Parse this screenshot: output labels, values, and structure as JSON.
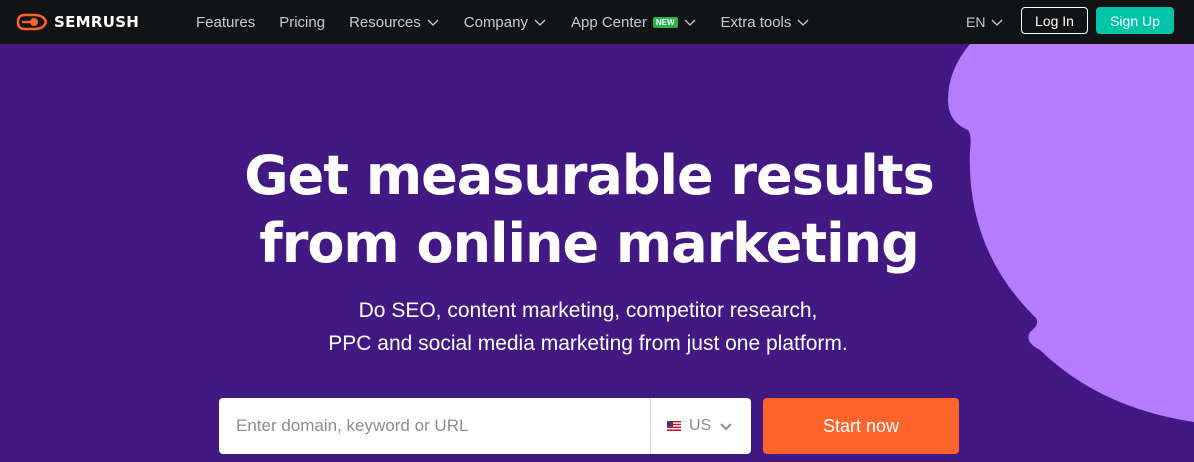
{
  "nav": {
    "logo_text": "SEMRUSH",
    "items": [
      {
        "label": "Features",
        "has_dropdown": false
      },
      {
        "label": "Pricing",
        "has_dropdown": false
      },
      {
        "label": "Resources",
        "has_dropdown": true
      },
      {
        "label": "Company",
        "has_dropdown": true
      },
      {
        "label": "App Center",
        "has_dropdown": true,
        "badge": "NEW"
      },
      {
        "label": "Extra tools",
        "has_dropdown": true
      }
    ],
    "language": "EN",
    "login_label": "Log In",
    "signup_label": "Sign Up"
  },
  "hero": {
    "headline_line1": "Get measurable results",
    "headline_line2": "from online marketing",
    "subtitle_line1": "Do SEO, content marketing, competitor research,",
    "subtitle_line2": "PPC and social media marketing from just one platform.",
    "search_placeholder": "Enter domain, keyword or URL",
    "database": "US",
    "start_label": "Start now"
  },
  "colors": {
    "nav_bg": "#121315",
    "hero_bg": "#421983",
    "decor_purple": "#b47cff",
    "signup_green": "#00c4a7",
    "start_orange": "#ff642d",
    "logo_orange": "#ff642d"
  },
  "icons": {
    "logo": "semrush-flame-icon",
    "dropdown": "chevron-down-icon",
    "flag": "us-flag-icon"
  }
}
